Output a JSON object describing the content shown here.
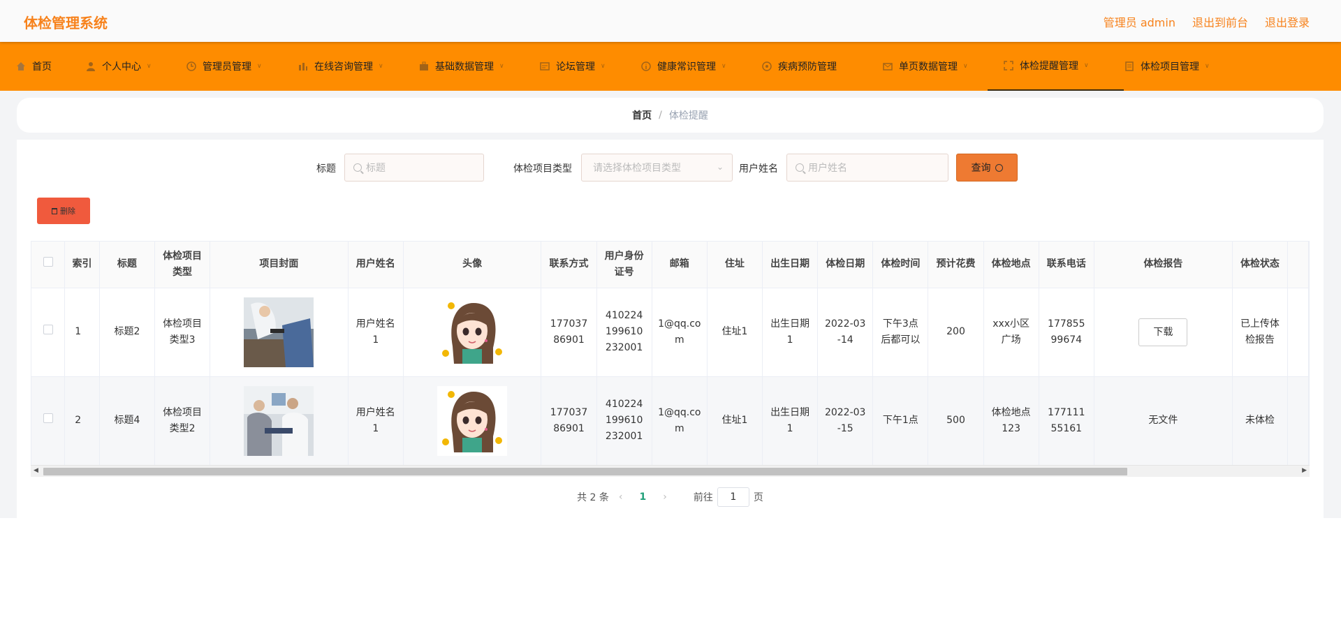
{
  "header": {
    "title": "体检管理系统",
    "links": [
      "管理员 admin",
      "退出到前台",
      "退出登录"
    ]
  },
  "nav": {
    "items": [
      {
        "label": "首页",
        "icon": "home-icon",
        "dropdown": false
      },
      {
        "label": "个人中心",
        "icon": "user-icon",
        "dropdown": true
      },
      {
        "label": "管理员管理",
        "icon": "clock-icon",
        "dropdown": true
      },
      {
        "label": "在线咨询管理",
        "icon": "chart-icon",
        "dropdown": true
      },
      {
        "label": "基础数据管理",
        "icon": "briefcase-icon",
        "dropdown": true
      },
      {
        "label": "论坛管理",
        "icon": "board-icon",
        "dropdown": true
      },
      {
        "label": "健康常识管理",
        "icon": "info-icon",
        "dropdown": true
      },
      {
        "label": "疾病预防管理",
        "icon": "shield-icon",
        "dropdown": false
      },
      {
        "label": "单页数据管理",
        "icon": "mail-icon",
        "dropdown": true
      },
      {
        "label": "体检提醒管理",
        "icon": "expand-icon",
        "dropdown": true
      },
      {
        "label": "体检项目管理",
        "icon": "doc-icon",
        "dropdown": true
      }
    ],
    "active_index": 9
  },
  "breadcrumb": {
    "home": "首页",
    "separator": "/",
    "current": "体检提醒"
  },
  "search": {
    "title_label": "标题",
    "title_placeholder": "标题",
    "type_label": "体检项目类型",
    "type_placeholder": "请选择体检项目类型",
    "user_label": "用户姓名",
    "user_placeholder": "用户姓名",
    "query_button": "查询"
  },
  "actions": {
    "delete_button": "删除"
  },
  "table": {
    "headers": [
      "索引",
      "标题",
      "体检项目类型",
      "项目封面",
      "用户姓名",
      "头像",
      "联系方式",
      "用户身份证号",
      "邮箱",
      "住址",
      "出生日期",
      "体检日期",
      "体检时间",
      "预计花费",
      "体检地点",
      "联系电话",
      "体检报告",
      "体检状态"
    ],
    "rows": [
      {
        "index": "1",
        "title": "标题2",
        "type": "体检项目类型3",
        "user": "用户姓名1",
        "phone": "17703786901",
        "idcard": "410224199610232001",
        "email": "1@qq.com",
        "address": "住址1",
        "birth": "出生日期1",
        "exam_date": "2022-03-14",
        "exam_time": "下午3点后都可以",
        "cost": "200",
        "place": "xxx小区广场",
        "tel": "17785599674",
        "report": "下载",
        "report_is_button": true,
        "status": "已上传体检报告"
      },
      {
        "index": "2",
        "title": "标题4",
        "type": "体检项目类型2",
        "user": "用户姓名1",
        "phone": "17703786901",
        "idcard": "410224199610232001",
        "email": "1@qq.com",
        "address": "住址1",
        "birth": "出生日期1",
        "exam_date": "2022-03-15",
        "exam_time": "下午1点",
        "cost": "500",
        "place": "体检地点123",
        "tel": "17711155161",
        "report": "无文件",
        "report_is_button": false,
        "status": "未体检"
      }
    ]
  },
  "pagination": {
    "total_text": "共 2 条",
    "current_page": "1",
    "goto_label": "前往",
    "goto_value": "1",
    "page_suffix": "页"
  },
  "colors": {
    "accent": "#fe8c00",
    "title": "#f7821c",
    "delete": "#f05a3d",
    "query": "#ee7a32"
  }
}
